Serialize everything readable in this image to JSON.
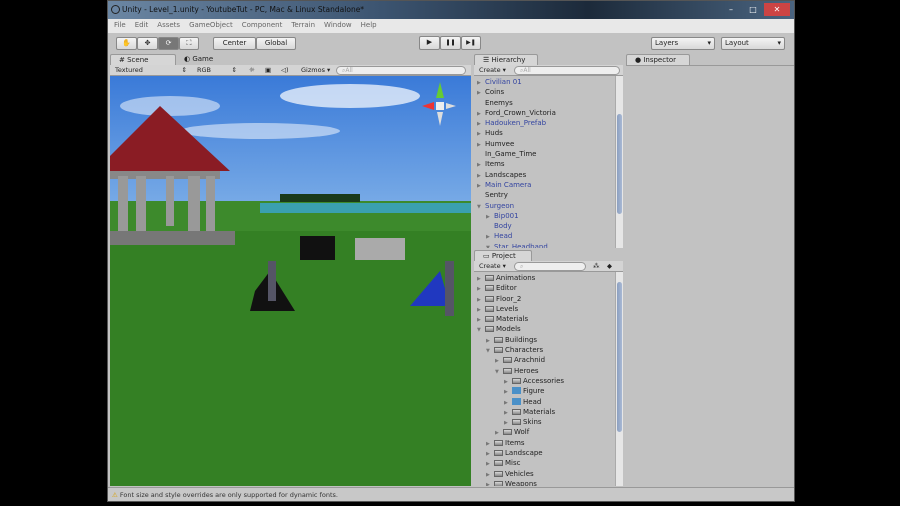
{
  "window": {
    "title": "Unity - Level_1.unity - YoutubeTut - PC, Mac & Linux Standalone*",
    "controls": [
      "–",
      "□",
      "✕"
    ]
  },
  "menu": [
    "File",
    "Edit",
    "Assets",
    "GameObject",
    "Component",
    "Terrain",
    "Window",
    "Help"
  ],
  "toolbar": {
    "tools": [
      "hand-icon",
      "move-icon",
      "rotate-icon",
      "scale-icon"
    ],
    "pivot": "Center",
    "space": "Global",
    "play": "▶",
    "pause": "❚❚",
    "step": "▶❚",
    "layers": "Layers",
    "layout": "Layout"
  },
  "scene": {
    "tab_scene": "# Scene",
    "tab_game": "Game",
    "render_mode": "Textured",
    "color_mode": "RGB",
    "gizmos": "Gizmos",
    "search_placeholder": "All"
  },
  "hierarchy": {
    "tab": "Hierarchy",
    "create": "Create",
    "search_placeholder": "All",
    "items": [
      {
        "label": "Civilian 01",
        "arrow": "▶",
        "indent": 0,
        "blue": true
      },
      {
        "label": "Coins",
        "arrow": "▶",
        "indent": 0,
        "blue": false
      },
      {
        "label": "Enemys",
        "arrow": "",
        "indent": 0,
        "blue": false
      },
      {
        "label": "Ford_Crown_Victoria",
        "arrow": "▶",
        "indent": 0,
        "blue": false
      },
      {
        "label": "Hadouken_Prefab",
        "arrow": "▶",
        "indent": 0,
        "blue": true
      },
      {
        "label": "Huds",
        "arrow": "▶",
        "indent": 0,
        "blue": false
      },
      {
        "label": "Humvee",
        "arrow": "▶",
        "indent": 0,
        "blue": false
      },
      {
        "label": "In_Game_Time",
        "arrow": "",
        "indent": 0,
        "blue": false
      },
      {
        "label": "Items",
        "arrow": "▶",
        "indent": 0,
        "blue": false
      },
      {
        "label": "Landscapes",
        "arrow": "▶",
        "indent": 0,
        "blue": false
      },
      {
        "label": "Main Camera",
        "arrow": "▶",
        "indent": 0,
        "blue": true
      },
      {
        "label": "Sentry",
        "arrow": "",
        "indent": 0,
        "blue": false
      },
      {
        "label": "Surgeon",
        "arrow": "▼",
        "indent": 0,
        "blue": true
      },
      {
        "label": "Bip001",
        "arrow": "▶",
        "indent": 1,
        "blue": true
      },
      {
        "label": "Body",
        "arrow": "",
        "indent": 1,
        "blue": true
      },
      {
        "label": "Head",
        "arrow": "▶",
        "indent": 1,
        "blue": true
      },
      {
        "label": "Star_Headband",
        "arrow": "▼",
        "indent": 1,
        "blue": true
      }
    ]
  },
  "project": {
    "tab": "Project",
    "create": "Create",
    "items": [
      {
        "label": "Animations",
        "arrow": "▶",
        "indent": 0,
        "icon": "folder"
      },
      {
        "label": "Editor",
        "arrow": "▶",
        "indent": 0,
        "icon": "folder"
      },
      {
        "label": "Floor_2",
        "arrow": "▶",
        "indent": 0,
        "icon": "folder"
      },
      {
        "label": "Levels",
        "arrow": "▶",
        "indent": 0,
        "icon": "folder"
      },
      {
        "label": "Materials",
        "arrow": "▶",
        "indent": 0,
        "icon": "folder"
      },
      {
        "label": "Models",
        "arrow": "▼",
        "indent": 0,
        "icon": "folder"
      },
      {
        "label": "Buildings",
        "arrow": "▶",
        "indent": 1,
        "icon": "folder"
      },
      {
        "label": "Characters",
        "arrow": "▼",
        "indent": 1,
        "icon": "folder"
      },
      {
        "label": "Arachnid",
        "arrow": "▶",
        "indent": 2,
        "icon": "folder"
      },
      {
        "label": "Heroes",
        "arrow": "▼",
        "indent": 2,
        "icon": "folder"
      },
      {
        "label": "Accessories",
        "arrow": "▶",
        "indent": 3,
        "icon": "folder"
      },
      {
        "label": "Figure",
        "arrow": "▶",
        "indent": 3,
        "icon": "mesh"
      },
      {
        "label": "Head",
        "arrow": "▶",
        "indent": 3,
        "icon": "mesh"
      },
      {
        "label": "Materials",
        "arrow": "▶",
        "indent": 3,
        "icon": "folder"
      },
      {
        "label": "Skins",
        "arrow": "▶",
        "indent": 3,
        "icon": "folder"
      },
      {
        "label": "Wolf",
        "arrow": "▶",
        "indent": 2,
        "icon": "folder"
      },
      {
        "label": "Items",
        "arrow": "▶",
        "indent": 1,
        "icon": "folder"
      },
      {
        "label": "Landscape",
        "arrow": "▶",
        "indent": 1,
        "icon": "folder"
      },
      {
        "label": "Misc",
        "arrow": "▶",
        "indent": 1,
        "icon": "folder"
      },
      {
        "label": "Vehicles",
        "arrow": "▶",
        "indent": 1,
        "icon": "folder"
      },
      {
        "label": "Weapons",
        "arrow": "▶",
        "indent": 1,
        "icon": "folder"
      }
    ]
  },
  "inspector": {
    "tab": "Inspector"
  },
  "status": {
    "message": "Font size and style overrides are only supported for dynamic fonts.",
    "icon": "warning-icon"
  }
}
